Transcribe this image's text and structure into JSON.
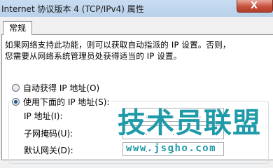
{
  "window": {
    "title": "Internet 协议版本 4 (TCP/IPv4) 属性",
    "close_glyph": "X"
  },
  "tabs": [
    {
      "label": "常规",
      "selected": true
    }
  ],
  "description": {
    "line1": "如果网络支持此功能，则可以获取自动指派的 IP 设置。否则，",
    "line2": "您需要从网络系统管理员处获得适当的 IP 设置。"
  },
  "options": {
    "auto": {
      "label": "自动获得 IP 地址(O)",
      "checked": false
    },
    "manual": {
      "label": "使用下面的 IP 地址(S):",
      "checked": true
    }
  },
  "fields": {
    "ip_label": "IP 地址(I):",
    "mask_label": "子网掩码(U):",
    "gateway_label": "默认网关(D):"
  },
  "watermark": {
    "text": "技术员联盟",
    "url": "www.jsgho.com"
  },
  "colors": {
    "title_bar": "#c9dcf1",
    "close_button": "#c7503c",
    "watermark": "#1f9aa8"
  }
}
